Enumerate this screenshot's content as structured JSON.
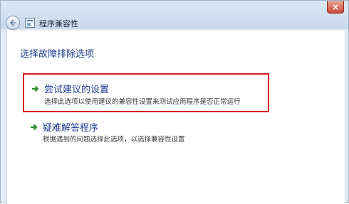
{
  "window": {
    "title": "程序兼容性",
    "close_symbol": "×"
  },
  "main": {
    "heading": "选择故障排除选项",
    "options": [
      {
        "title": "尝试建议的设置",
        "description": "选择此选项以使用建议的兼容性设置来测试应用程序是否正常运行",
        "highlighted": true,
        "icon": "green-arrow-icon"
      },
      {
        "title": "疑难解答程序",
        "description": "根据遇到的问题选择此选项，以选择兼容性设置",
        "highlighted": false,
        "icon": "green-arrow-icon"
      }
    ]
  },
  "colors": {
    "link_blue": "#1a3d8f",
    "highlight_red": "#d21f24",
    "arrow_green": "#2e8b2e"
  }
}
